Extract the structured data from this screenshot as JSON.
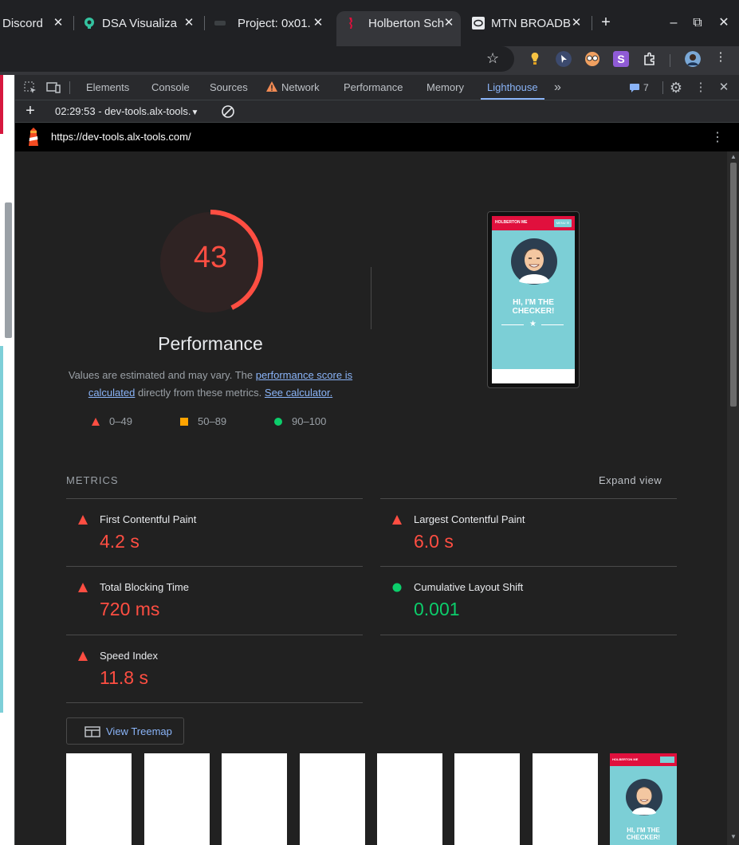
{
  "browser": {
    "tabs": [
      {
        "title": "Discord",
        "favicon": "discord-icon"
      },
      {
        "title": "DSA Visualiza",
        "favicon": "dsa-visualizer-icon"
      },
      {
        "title": "Project: 0x01.",
        "favicon": "project-icon"
      },
      {
        "title": "Holberton Sch",
        "favicon": "holberton-icon",
        "active": true
      },
      {
        "title": "MTN BROADB",
        "favicon": "mtn-icon"
      }
    ],
    "new_tab": "+",
    "window_controls": {
      "minimize": "–",
      "restore": "⧉",
      "close": "✕"
    }
  },
  "devtools": {
    "tabs": [
      "Elements",
      "Console",
      "Sources",
      "Network",
      "Performance",
      "Memory",
      "Lighthouse"
    ],
    "active_tab": "Lighthouse",
    "more_tabs": "»",
    "issues_count": "7",
    "report_selector": "02:29:53 - dev-tools.alx-tools.",
    "add_report": "+",
    "url": "https://dev-tools.alx-tools.com/"
  },
  "lighthouse": {
    "score": "43",
    "score_fraction": 0.43,
    "category": "Performance",
    "description": {
      "prefix": "Values are estimated and may vary. The ",
      "link1": "performance score is calculated",
      "middle": " directly from these metrics. ",
      "link2": "See calculator."
    },
    "scale": [
      {
        "label": "0–49",
        "color": "#ff4e42",
        "shape": "triangle"
      },
      {
        "label": "50–89",
        "color": "#ffa400",
        "shape": "square"
      },
      {
        "label": "90–100",
        "color": "#0cce6b",
        "shape": "circle"
      }
    ],
    "metrics_heading": "METRICS",
    "expand_view": "Expand view",
    "metrics": [
      {
        "name": "First Contentful Paint",
        "value": "4.2 s",
        "status": "fail"
      },
      {
        "name": "Largest Contentful Paint",
        "value": "6.0 s",
        "status": "fail"
      },
      {
        "name": "Total Blocking Time",
        "value": "720 ms",
        "status": "fail"
      },
      {
        "name": "Cumulative Layout Shift",
        "value": "0.001",
        "status": "pass"
      },
      {
        "name": "Speed Index",
        "value": "11.8 s",
        "status": "fail"
      }
    ],
    "view_treemap": "View Treemap",
    "preview": {
      "brand": "HOLBERTON ME",
      "menu": "MENU ☰",
      "headline": "HI, I'M THE CHECKER!"
    }
  },
  "colors": {
    "fail": "#ff4e42",
    "average": "#ffa400",
    "pass": "#0cce6b",
    "link": "#8ab4f8",
    "holberton_red": "#e0103d",
    "preview_teal": "#7ccfd6"
  }
}
